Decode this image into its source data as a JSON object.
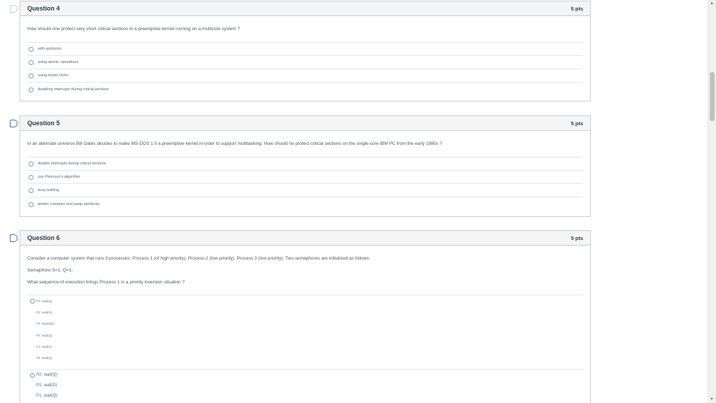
{
  "questions": [
    {
      "title": "Question 4",
      "points": "5 pts",
      "prompt": "How should one protect very short critical sections in a preemptive kernel running on a multicore system ?",
      "answers": [
        "with spinlocks",
        "using atomic operations",
        "using mutex locks",
        "disabling interrupts during critical sections"
      ]
    },
    {
      "title": "Question 5",
      "points": "5 pts",
      "prompt": "In an alternate universe Bill Gates decides to make MS-DOS 1.0 a preemptive kernel in order to support  multitasking. How should he protect critical sections on the single-core IBM PC from the early 1980s ?",
      "answers": [
        "disable interrupts during critical sections",
        "use Peterson's algorithm",
        "busy waiting",
        "atomic compare and swap spinlocks"
      ]
    },
    {
      "title": "Question 6",
      "points": "5 pts",
      "prompt": "Consider a computer system that runs 3 processes: Process 1 (of high priority), Process 2 (low priority), Process 3 (low priority). Two semaphores  are initialized as follows:",
      "semaphores": "Semaphore S=1, Q=1;",
      "question": "What sequence of execution brings Process 1 in a priority inversion situation ?",
      "option_a": [
        "P1: wait(Q)",
        "P2: wait(S)",
        "P3: signal(S)",
        "P2: wait(Q)",
        "P1: wait(S)",
        "P3: wait(Q)"
      ],
      "option_b": [
        "P2: wait(Q)",
        "P1: wait(S)",
        "P1: wait(Q)"
      ]
    }
  ],
  "scrollbar": {
    "thumb_icon": "scroll-thumb"
  }
}
